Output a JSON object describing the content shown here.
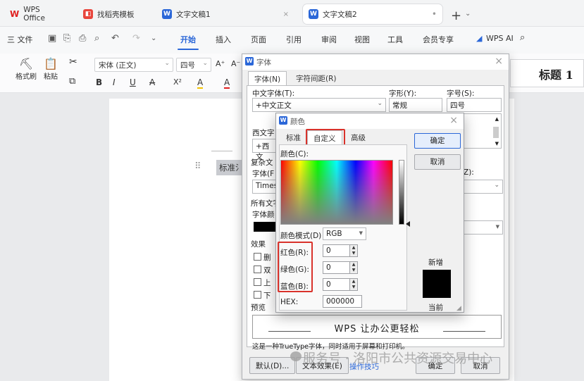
{
  "titlebar": {
    "app_name": "WPS Office",
    "tabs": [
      {
        "label": "找稻壳模板"
      },
      {
        "label": "文字文稿1"
      },
      {
        "label": "文字文稿2"
      }
    ],
    "plus": "+",
    "plus_dropdown": "⌄"
  },
  "menubar": {
    "file": "三 文件",
    "items": [
      "开始",
      "插入",
      "页面",
      "引用",
      "审阅",
      "视图",
      "工具",
      "会员专享"
    ],
    "wps_ai": "WPS AI",
    "search_icon": "search-icon"
  },
  "ribbon": {
    "format_painter": "格式刷",
    "paste": "粘贴",
    "font_name": "宋体 (正文)",
    "font_size": "四号",
    "grow": "A⁺",
    "shrink": "A⁻",
    "bold": "B",
    "italic": "I",
    "underline": "U",
    "strike": "A",
    "superscript": "X²",
    "highlight": "A",
    "fontcolor": "A",
    "heading_style": "标题 1"
  },
  "document": {
    "text": "标准氵"
  },
  "font_dialog": {
    "title": "字体",
    "close": "×",
    "tabs": [
      "字体(N)",
      "字符间距(R)"
    ],
    "cn_font_label": "中文字体(T):",
    "cn_font_value": "+中文正文",
    "style_label": "字形(Y):",
    "style_value": "常规",
    "size_label": "字号(S):",
    "size_value": "四号",
    "west_font_label": "西文字",
    "west_font_value": "+西文",
    "complex_label": "复杂文",
    "complex_font_label": "字体(F",
    "complex_font_value": "Times",
    "complex_size_label": "Z):",
    "all_text_label": "所有文字",
    "font_color_label": "字体颜",
    "effects_label": "效果",
    "effects": [
      "删",
      "双",
      "上",
      "下"
    ],
    "preview_label": "预览",
    "preview_text": "WPS 让办公更轻松",
    "preview_desc": "这是一种TrueType字体，同时适用于屏幕和打印机。",
    "buttons": {
      "default": "默认(D)...",
      "text_effects": "文本效果(E)",
      "tips": "操作技巧",
      "ok": "确定",
      "cancel": "取消"
    }
  },
  "color_dialog": {
    "title": "颜色",
    "close": "×",
    "tabs": [
      "标准",
      "自定义",
      "高级"
    ],
    "color_label": "颜色(C):",
    "mode_label": "颜色模式(D)",
    "mode_value": "RGB",
    "red_label": "红色(R):",
    "green_label": "绿色(G):",
    "blue_label": "蓝色(B):",
    "red": "0",
    "green": "0",
    "blue": "0",
    "hex_label": "HEX:",
    "hex": "000000",
    "new_label": "新增",
    "current_label": "当前",
    "ok": "确定",
    "cancel": "取消",
    "new_color": "#000000"
  },
  "watermark": "服务号 · 洛阳市公共资源交易中心",
  "colors": {
    "accent": "#2b67d8",
    "highlight_red": "#d9322b"
  }
}
